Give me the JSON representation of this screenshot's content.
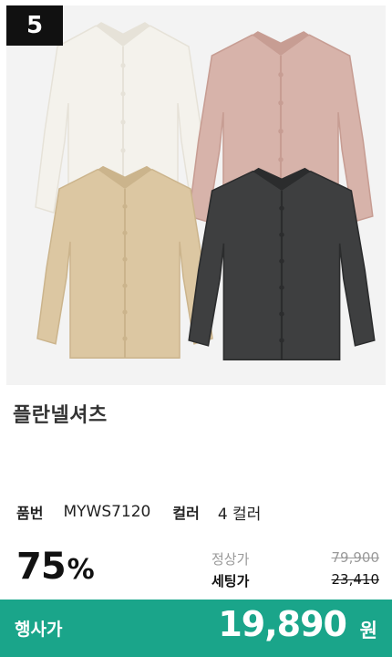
{
  "rank": "5",
  "product": {
    "title": "플란넬셔츠",
    "shirt_colors": [
      {
        "name": "white-shirt-icon",
        "color": "#f4f2ec",
        "shade": "#e6e2d8"
      },
      {
        "name": "pink-shirt-icon",
        "color": "#d7b3aa",
        "shade": "#c79d93"
      },
      {
        "name": "beige-shirt-icon",
        "color": "#dcc7a2",
        "shade": "#cbb48c"
      },
      {
        "name": "charcoal-shirt-icon",
        "color": "#3e3f40",
        "shade": "#2b2c2d"
      }
    ]
  },
  "spec": {
    "item_label": "품번",
    "item_value": "MYWS7120",
    "color_label": "컬러",
    "color_value": "4 컬러"
  },
  "pricing": {
    "discount_number": "75",
    "discount_symbol": "%",
    "regular_label": "정상가",
    "regular_price": "79,900",
    "set_label": "세팅가",
    "set_price": "23,410",
    "event_label": "행사가",
    "event_price": "19,890",
    "currency_unit": "원"
  },
  "colors": {
    "accent": "#1aa58a",
    "rank_bg": "#111111"
  }
}
